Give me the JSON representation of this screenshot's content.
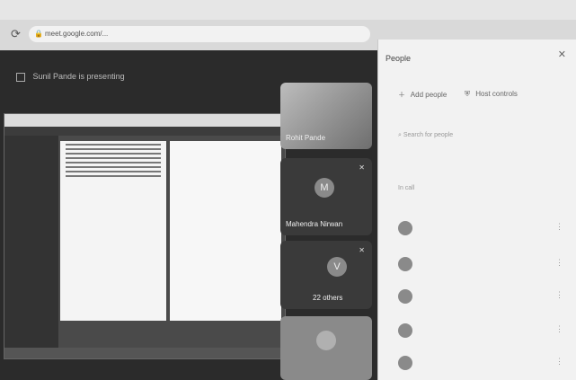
{
  "browser": {
    "url": "meet.google.com/..."
  },
  "meeting": {
    "presenting_label": "Sunil Pande is presenting"
  },
  "shared_screen": {
    "topbar_text": "",
    "right_doc_text": ""
  },
  "tiles": [
    {
      "name": "Rohit Pande",
      "initial": ""
    },
    {
      "name": "Mahendra Nirwan",
      "initial": "M"
    },
    {
      "name": "22 others",
      "initial": "V"
    },
    {
      "name": "",
      "initial": ""
    }
  ],
  "people": {
    "title": "People",
    "add_people": "Add people",
    "host_controls": "Host controls",
    "search_placeholder": "Search for people",
    "section_label": "In call",
    "entries": [
      "",
      "",
      "",
      "",
      ""
    ]
  },
  "icons": {
    "close": "close-icon",
    "reload": "reload-icon",
    "lock": "lock-icon",
    "mic_off": "mic-off-icon",
    "more": "more-vert-icon"
  }
}
